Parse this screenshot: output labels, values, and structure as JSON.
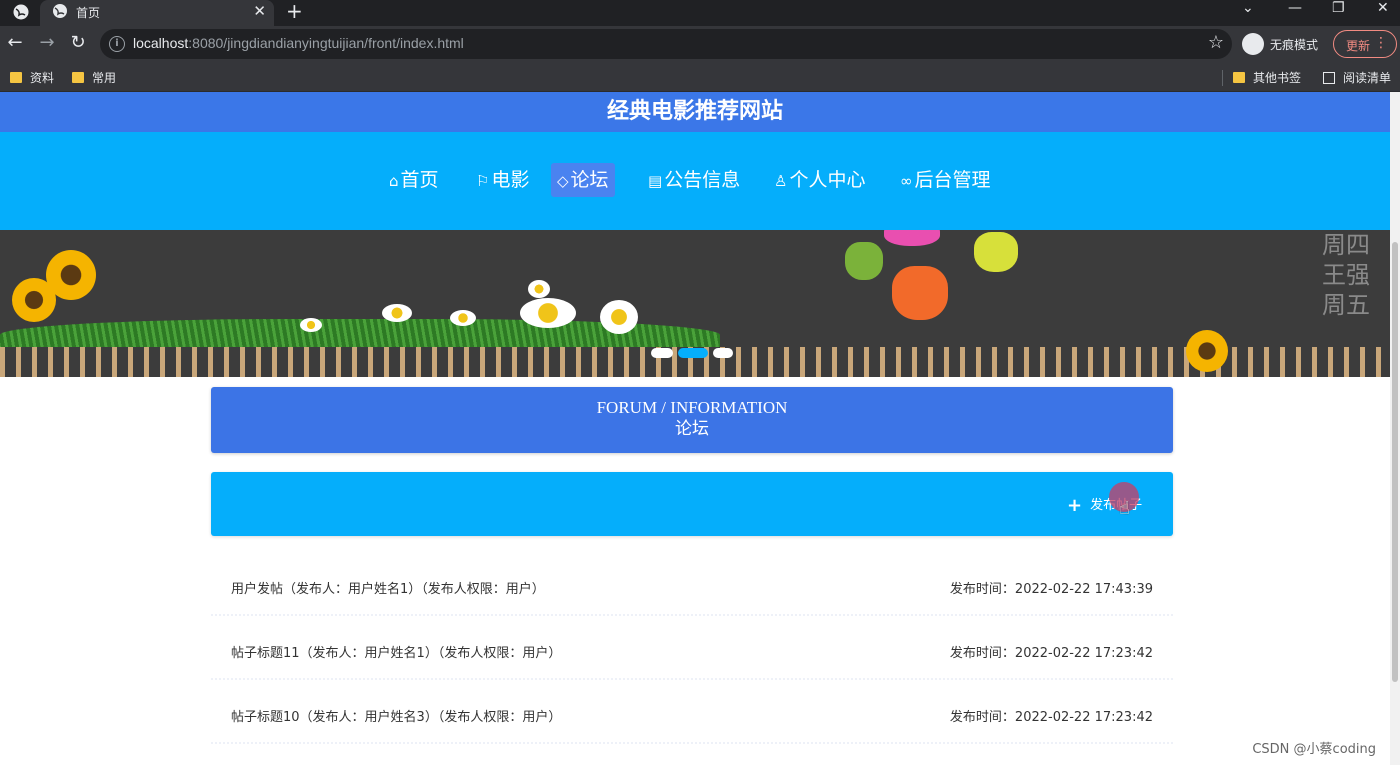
{
  "browser": {
    "tab_title": "首页",
    "url_host": "localhost",
    "url_rest": ":8080/jingdiandianyingtuijian/front/index.html",
    "incognito_label": "无痕模式",
    "update_label": "更新",
    "bookmarks": [
      "资料",
      "常用"
    ],
    "other_bookmarks": "其他书签",
    "reading_list": "阅读清单"
  },
  "site": {
    "title": "经典电影推荐网站",
    "nav": [
      {
        "icon": "home-icon",
        "label": "首页"
      },
      {
        "icon": "flag-icon",
        "label": "电影"
      },
      {
        "icon": "tag-icon",
        "label": "论坛"
      },
      {
        "icon": "notice-icon",
        "label": "公告信息"
      },
      {
        "icon": "user-icon",
        "label": "个人中心"
      },
      {
        "icon": "link-icon",
        "label": "后台管理"
      }
    ],
    "active_nav": "论坛"
  },
  "banner": {
    "chalk_text": [
      "周四",
      "王强",
      "周五"
    ],
    "active_slide": 2,
    "slide_count": 3
  },
  "forum": {
    "heading_en": "FORUM / INFORMATION",
    "heading_cn": "论坛",
    "post_button": "发布帖子",
    "posts": [
      {
        "title": "用户发帖（发布人：用户姓名1）（发布人权限：用户）",
        "time": "发布时间：2022-02-22 17:43:39"
      },
      {
        "title": "帖子标题11（发布人：用户姓名1）（发布人权限：用户）",
        "time": "发布时间：2022-02-22 17:23:42"
      },
      {
        "title": "帖子标题10（发布人：用户姓名3）（发布人权限：用户）",
        "time": "发布时间：2022-02-22 17:23:42"
      }
    ]
  },
  "watermark": "CSDN @小蔡coding",
  "colors": {
    "header_blue": "#3b77e8",
    "nav_cyan": "#05aefb",
    "active_nav": "#4a83f0",
    "section_blue": "#3c74e6"
  }
}
